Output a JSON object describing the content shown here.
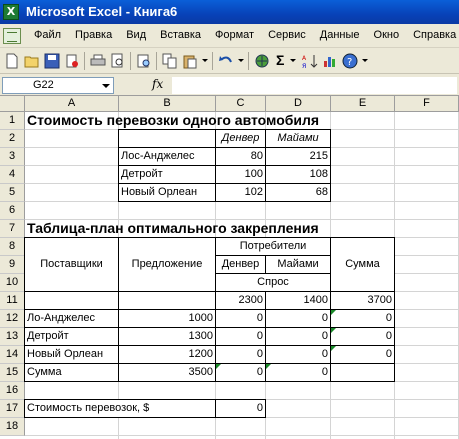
{
  "window": {
    "title": "Microsoft Excel - Книга6",
    "app_icon": "X"
  },
  "menu": {
    "items": [
      "Файл",
      "Правка",
      "Вид",
      "Вставка",
      "Формат",
      "Сервис",
      "Данные",
      "Окно",
      "Справка"
    ]
  },
  "toolbar": {
    "icons": [
      "new-icon",
      "open-icon",
      "save-icon",
      "permission-icon",
      "print-icon",
      "print-preview-icon",
      "research-icon",
      "copy-icon",
      "paste-icon",
      "undo-icon",
      "hyperlink-icon",
      "autosum-icon",
      "sort-icon",
      "chart-icon",
      "help-icon"
    ],
    "sigma": "Σ"
  },
  "formula_bar": {
    "name_box": "G22",
    "fx_label": "fx",
    "formula": ""
  },
  "grid": {
    "columns": [
      "A",
      "B",
      "C",
      "D",
      "E",
      "F"
    ],
    "rows": [
      "1",
      "2",
      "3",
      "4",
      "5",
      "6",
      "7",
      "8",
      "9",
      "10",
      "11",
      "12",
      "13",
      "14",
      "15",
      "16",
      "17",
      "18"
    ]
  },
  "sheet": {
    "title1": "Стоимость перевозки одного автомобиля",
    "cost_table": {
      "headers": [
        "Денвер",
        "Майами"
      ],
      "rows": [
        {
          "name": "Лос-Анджелес",
          "values": [
            "80",
            "215"
          ]
        },
        {
          "name": "Детройт",
          "values": [
            "100",
            "108"
          ]
        },
        {
          "name": "Новый Орлеан",
          "values": [
            "102",
            "68"
          ]
        }
      ]
    },
    "title2": "Таблица-план оптимального закрепления",
    "plan_table": {
      "suppliers_label": "Поставщики",
      "supply_label": "Предложение",
      "consumers_label": "Потребители",
      "sum_label": "Сумма",
      "demand_label": "Спрос",
      "consumers": [
        "Денвер",
        "Майами"
      ],
      "demand": [
        "2300",
        "1400",
        "3700"
      ],
      "rows": [
        {
          "name": "Ло-Анджелес",
          "supply": "1000",
          "values": [
            "0",
            "0"
          ],
          "sum": "0"
        },
        {
          "name": "Детройт",
          "supply": "1300",
          "values": [
            "0",
            "0"
          ],
          "sum": "0"
        },
        {
          "name": "Новый Орлеан",
          "supply": "1200",
          "values": [
            "0",
            "0"
          ],
          "sum": "0"
        }
      ],
      "total": {
        "name": "Сумма",
        "supply": "3500",
        "values": [
          "0",
          "0"
        ]
      }
    },
    "cost_label": "Стоимость перевозок, $",
    "cost_value": "0"
  }
}
